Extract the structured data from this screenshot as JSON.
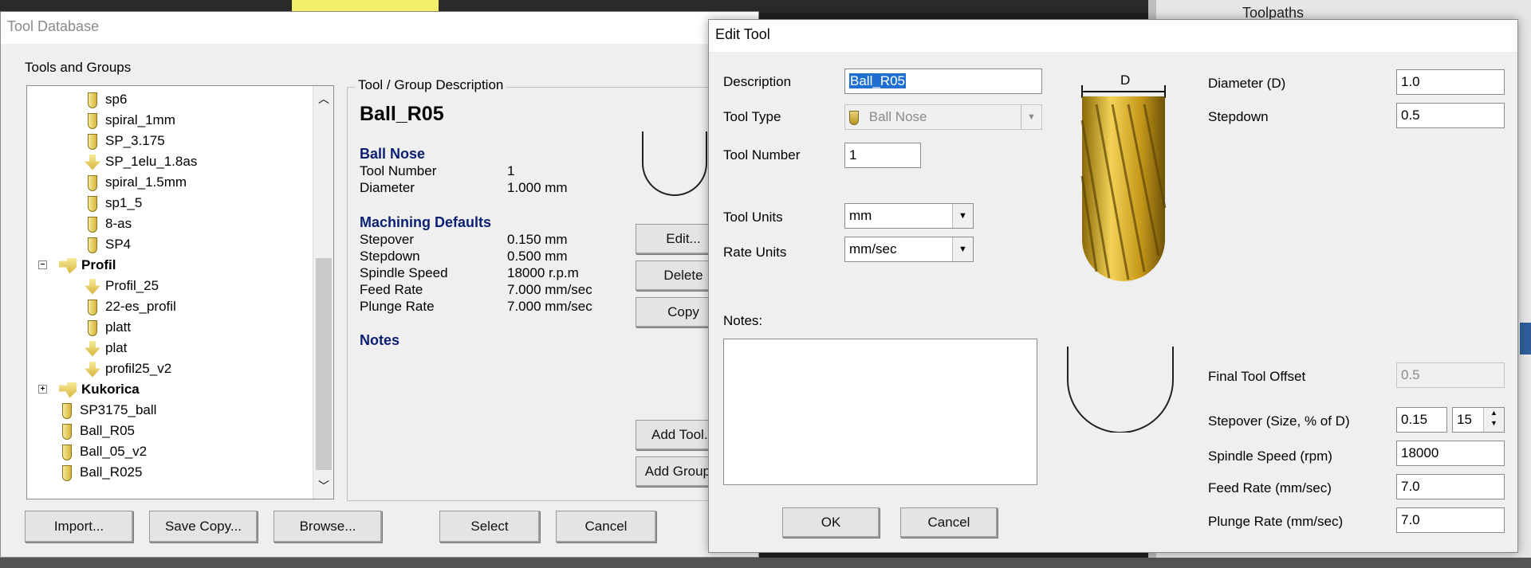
{
  "background": {
    "tree_label": "Toolpaths"
  },
  "tool_db": {
    "title": "Tool Database",
    "tools_groups_label": "Tools and Groups",
    "tree": [
      {
        "label": "sp6",
        "icon": "ball-tool-icon",
        "bold": false
      },
      {
        "label": "spiral_1mm",
        "icon": "ball-tool-icon",
        "bold": false
      },
      {
        "label": "SP_3.175",
        "icon": "ball-tool-icon",
        "bold": false
      },
      {
        "label": "SP_1elu_1.8as",
        "icon": "vbit-tool-icon",
        "bold": false
      },
      {
        "label": "spiral_1.5mm",
        "icon": "ball-tool-icon",
        "bold": false
      },
      {
        "label": "sp1_5",
        "icon": "ball-tool-icon",
        "bold": false
      },
      {
        "label": "8-as",
        "icon": "ball-tool-icon",
        "bold": false
      },
      {
        "label": "SP4",
        "icon": "ball-tool-icon",
        "bold": false
      },
      {
        "label": "Profil",
        "icon": "group-icon",
        "bold": true
      },
      {
        "label": "Profil_25",
        "icon": "vbit-tool-icon",
        "bold": false
      },
      {
        "label": "22-es_profil",
        "icon": "ball-tool-icon",
        "bold": false
      },
      {
        "label": "platt",
        "icon": "ball-tool-icon",
        "bold": false
      },
      {
        "label": "plat",
        "icon": "vbit-tool-icon",
        "bold": false
      },
      {
        "label": "profil25_v2",
        "icon": "vbit-tool-icon",
        "bold": false
      },
      {
        "label": "Kukorica",
        "icon": "group-icon",
        "bold": true
      },
      {
        "label": "SP3175_ball",
        "icon": "ball-tool-icon",
        "bold": false
      },
      {
        "label": "Ball_R05",
        "icon": "ball-tool-icon",
        "bold": false
      },
      {
        "label": "Ball_05_v2",
        "icon": "ball-tool-icon",
        "bold": false
      },
      {
        "label": "Ball_R025",
        "icon": "ball-tool-icon",
        "bold": false
      }
    ],
    "group_desc_label": "Tool / Group Description",
    "tool_name": "Ball_R05",
    "tool_type": "Ball Nose",
    "info": [
      {
        "k": "Tool Number",
        "v": "1"
      },
      {
        "k": "Diameter",
        "v": "1.000 mm"
      }
    ],
    "machining_defaults_label": "Machining Defaults",
    "defaults": [
      {
        "k": "Stepover",
        "v": "0.150 mm"
      },
      {
        "k": "Stepdown",
        "v": "0.500 mm"
      },
      {
        "k": "Spindle Speed",
        "v": "18000 r.p.m"
      },
      {
        "k": "Feed Rate",
        "v": "7.000 mm/sec"
      },
      {
        "k": "Plunge Rate",
        "v": "7.000 mm/sec"
      }
    ],
    "notes_label": "Notes",
    "buttons": {
      "edit": "Edit...",
      "delete": "Delete",
      "copy": "Copy",
      "add_tool": "Add Tool...",
      "add_group": "Add Group...",
      "import": "Import...",
      "save_copy": "Save Copy...",
      "browse": "Browse...",
      "select": "Select",
      "cancel": "Cancel"
    }
  },
  "edit_tool": {
    "title": "Edit Tool",
    "description_label": "Description",
    "description_value": "Ball_R05",
    "tool_type_label": "Tool Type",
    "tool_type_value": "Ball Nose",
    "tool_number_label": "Tool Number",
    "tool_number_value": "1",
    "tool_units_label": "Tool Units",
    "tool_units_value": "mm",
    "rate_units_label": "Rate Units",
    "rate_units_value": "mm/sec",
    "notes_label": "Notes:",
    "notes_value": "",
    "diagram_label": "D",
    "diameter_label": "Diameter (D)",
    "diameter_value": "1.0",
    "stepdown_label": "Stepdown",
    "stepdown_value": "0.5",
    "final_offset_label": "Final Tool Offset",
    "final_offset_value": "0.5",
    "stepover_label": "Stepover (Size, % of D)",
    "stepover_size_value": "0.15",
    "stepover_percent_value": "15",
    "spindle_label": "Spindle Speed (rpm)",
    "spindle_value": "18000",
    "feed_label": "Feed Rate (mm/sec)",
    "feed_value": "7.0",
    "plunge_label": "Plunge Rate (mm/sec)",
    "plunge_value": "7.0",
    "ok": "OK",
    "cancel": "Cancel"
  }
}
